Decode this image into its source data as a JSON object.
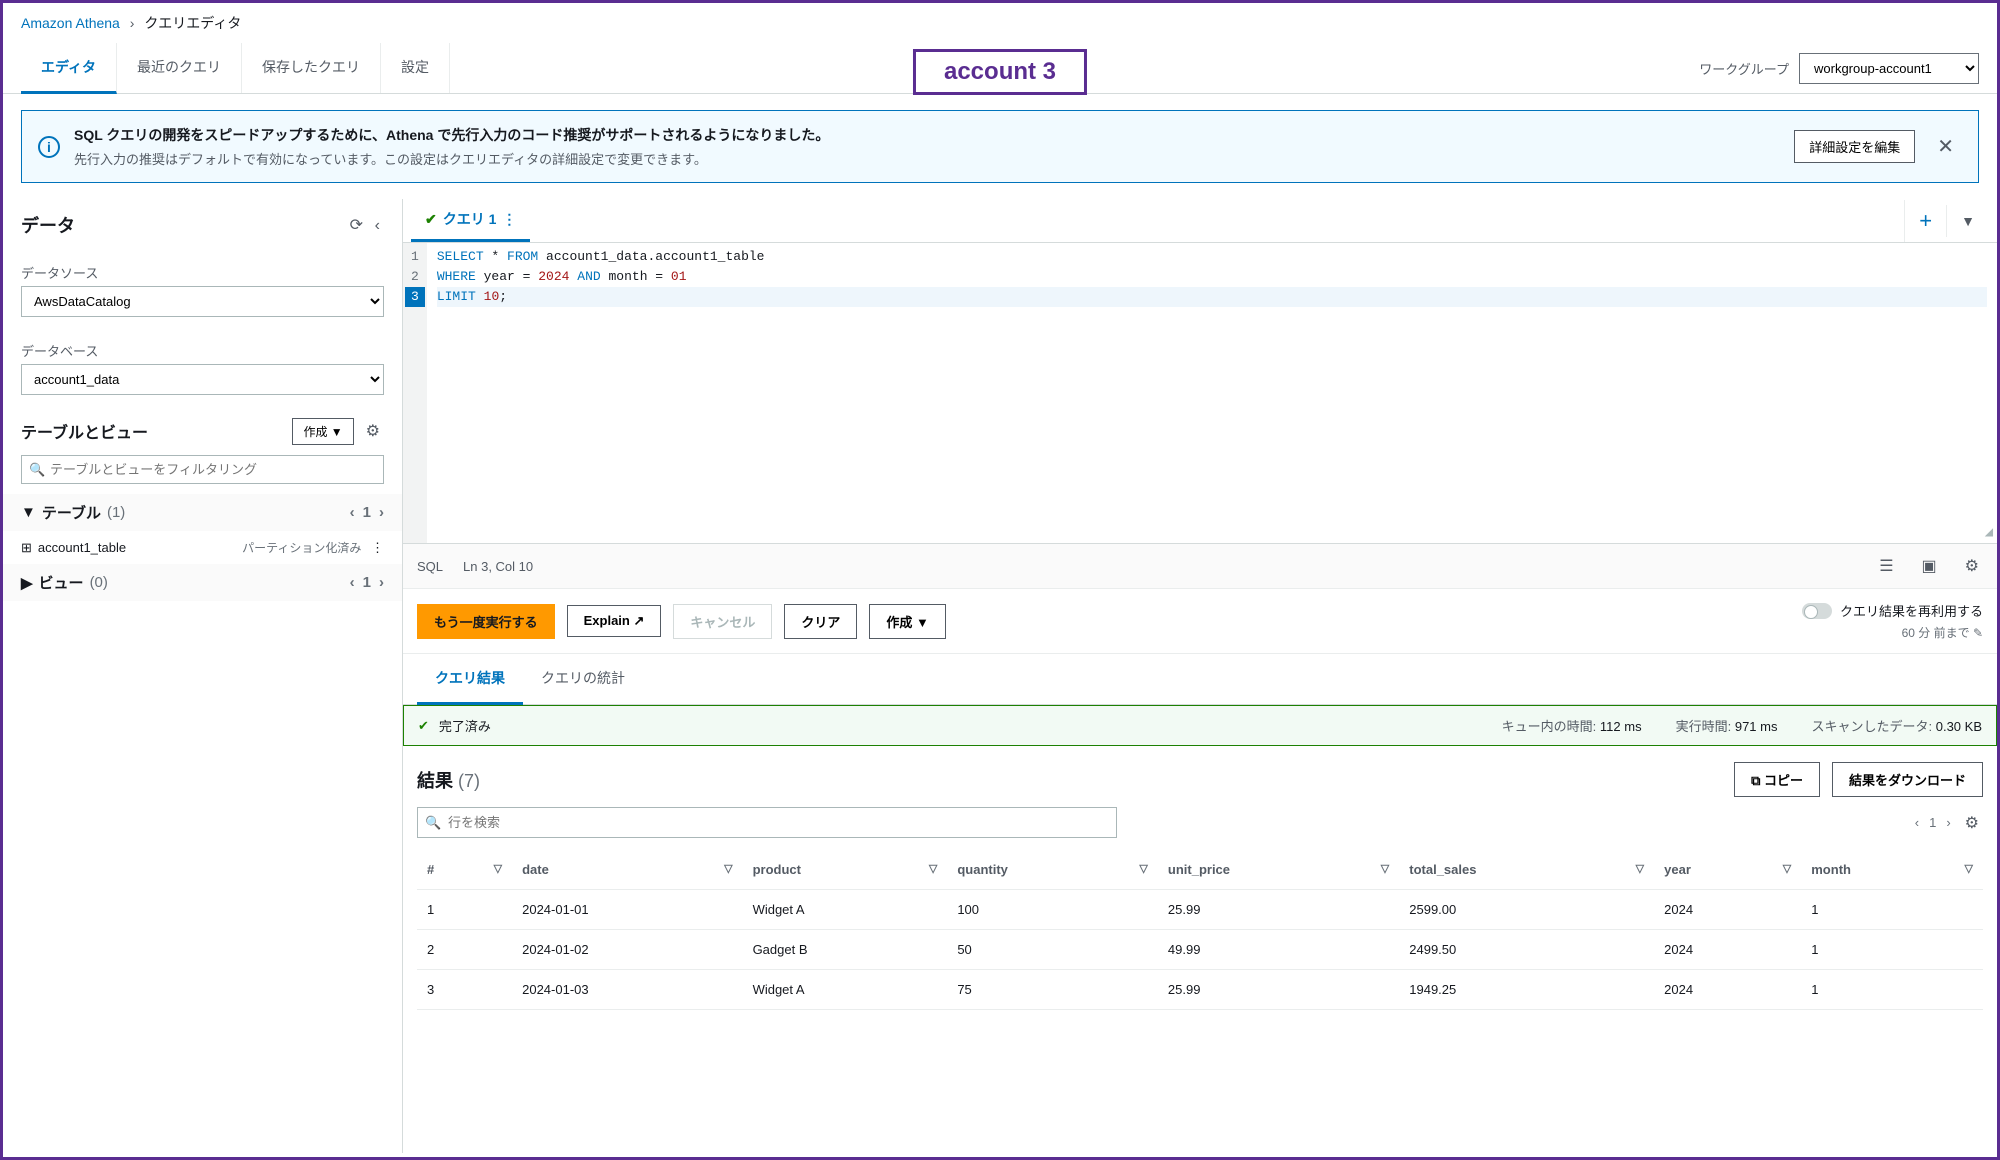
{
  "breadcrumb": {
    "service": "Amazon Athena",
    "page": "クエリエディタ"
  },
  "tabs": [
    "エディタ",
    "最近のクエリ",
    "保存したクエリ",
    "設定"
  ],
  "account_badge": "account 3",
  "workgroup": {
    "label": "ワークグループ",
    "value": "workgroup-account1"
  },
  "banner": {
    "title": "SQL クエリの開発をスピードアップするために、Athena で先行入力のコード推奨がサポートされるようになりました。",
    "sub": "先行入力の推奨はデフォルトで有効になっています。この設定はクエリエディタの詳細設定で変更できます。",
    "button": "詳細設定を編集"
  },
  "left": {
    "heading": "データ",
    "datasource_label": "データソース",
    "datasource_value": "AwsDataCatalog",
    "database_label": "データベース",
    "database_value": "account1_data",
    "tables_views_heading": "テーブルとビュー",
    "create_button": "作成 ▼",
    "filter_placeholder": "テーブルとビューをフィルタリング",
    "tables": {
      "label": "テーブル",
      "count": "(1)",
      "page": "1"
    },
    "table_item": {
      "name": "account1_table",
      "meta": "パーティション化済み"
    },
    "views": {
      "label": "ビュー",
      "count": "(0)",
      "page": "1"
    }
  },
  "query": {
    "tab_label": "クエリ 1",
    "lines": [
      {
        "n": "1",
        "tokens": [
          [
            "kw",
            "SELECT"
          ],
          [
            "",
            " * "
          ],
          [
            "kw",
            "FROM"
          ],
          [
            "",
            " account1_data.account1_table"
          ]
        ]
      },
      {
        "n": "2",
        "tokens": [
          [
            "kw",
            "WHERE"
          ],
          [
            "",
            " year = "
          ],
          [
            "num",
            "2024"
          ],
          [
            "",
            " "
          ],
          [
            "kw",
            "AND"
          ],
          [
            "",
            " month = "
          ],
          [
            "num",
            "01"
          ]
        ]
      },
      {
        "n": "3",
        "tokens": [
          [
            "kw",
            "LIMIT"
          ],
          [
            "",
            " "
          ],
          [
            "num",
            "10"
          ],
          [
            "",
            ";"
          ]
        ]
      }
    ],
    "active_line": 3,
    "status_lang": "SQL",
    "status_pos": "Ln 3, Col 10"
  },
  "actions": {
    "run": "もう一度実行する",
    "explain": "Explain ↗",
    "cancel": "キャンセル",
    "clear": "クリア",
    "create": "作成 ▼",
    "reuse_label": "クエリ結果を再利用する",
    "reuse_sub": "60 分 前まで ✎"
  },
  "results_tabs": [
    "クエリ結果",
    "クエリの統計"
  ],
  "completed": {
    "label": "完了済み",
    "queue_label": "キュー内の時間:",
    "queue_value": "112 ms",
    "run_label": "実行時間:",
    "run_value": "971 ms",
    "scan_label": "スキャンしたデータ:",
    "scan_value": "0.30 KB"
  },
  "results": {
    "heading": "結果",
    "count": "(7)",
    "copy": "⧉ コピー",
    "download": "結果をダウンロード",
    "search_placeholder": "行を検索",
    "page": "1",
    "columns": [
      "#",
      "date",
      "product",
      "quantity",
      "unit_price",
      "total_sales",
      "year",
      "month"
    ],
    "rows": [
      [
        "1",
        "2024-01-01",
        "Widget A",
        "100",
        "25.99",
        "2599.00",
        "2024",
        "1"
      ],
      [
        "2",
        "2024-01-02",
        "Gadget B",
        "50",
        "49.99",
        "2499.50",
        "2024",
        "1"
      ],
      [
        "3",
        "2024-01-03",
        "Widget A",
        "75",
        "25.99",
        "1949.25",
        "2024",
        "1"
      ]
    ]
  }
}
